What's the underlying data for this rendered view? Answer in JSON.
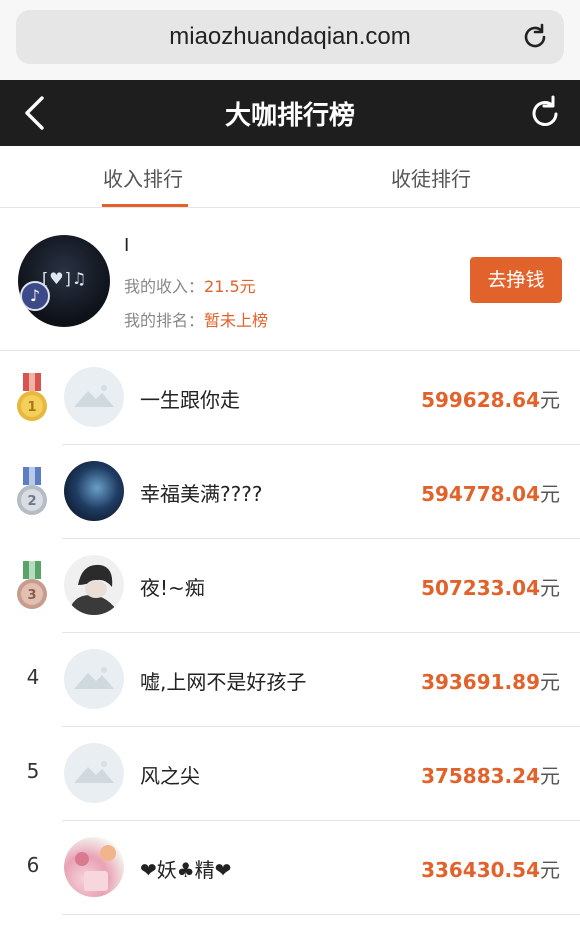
{
  "browser": {
    "url": "miaozhuandaqian.com"
  },
  "nav": {
    "title": "大咖排行榜"
  },
  "tabs": [
    {
      "label": "收入排行",
      "active": true
    },
    {
      "label": "收徒排行",
      "active": false
    }
  ],
  "me": {
    "name": "I",
    "income_label": "我的收入：",
    "income_value": "21.5元",
    "rank_label": "我的排名：",
    "rank_value": "暂未上榜",
    "button_label": "去挣钱"
  },
  "ranking": [
    {
      "rank": "1",
      "name": "一生跟你走",
      "amount": "599628.64",
      "unit": "元"
    },
    {
      "rank": "2",
      "name": "幸福美满????",
      "amount": "594778.04",
      "unit": "元"
    },
    {
      "rank": "3",
      "name": "夜!~痴",
      "amount": "507233.04",
      "unit": "元"
    },
    {
      "rank": "4",
      "name": "嘘,上网不是好孩子",
      "amount": "393691.89",
      "unit": "元"
    },
    {
      "rank": "5",
      "name": "风之尖",
      "amount": "375883.24",
      "unit": "元"
    },
    {
      "rank": "6",
      "name": "❤妖♣精❤",
      "amount": "336430.54",
      "unit": "元"
    }
  ],
  "colors": {
    "accent": "#e2622b",
    "navbar": "#1e1e1e"
  }
}
